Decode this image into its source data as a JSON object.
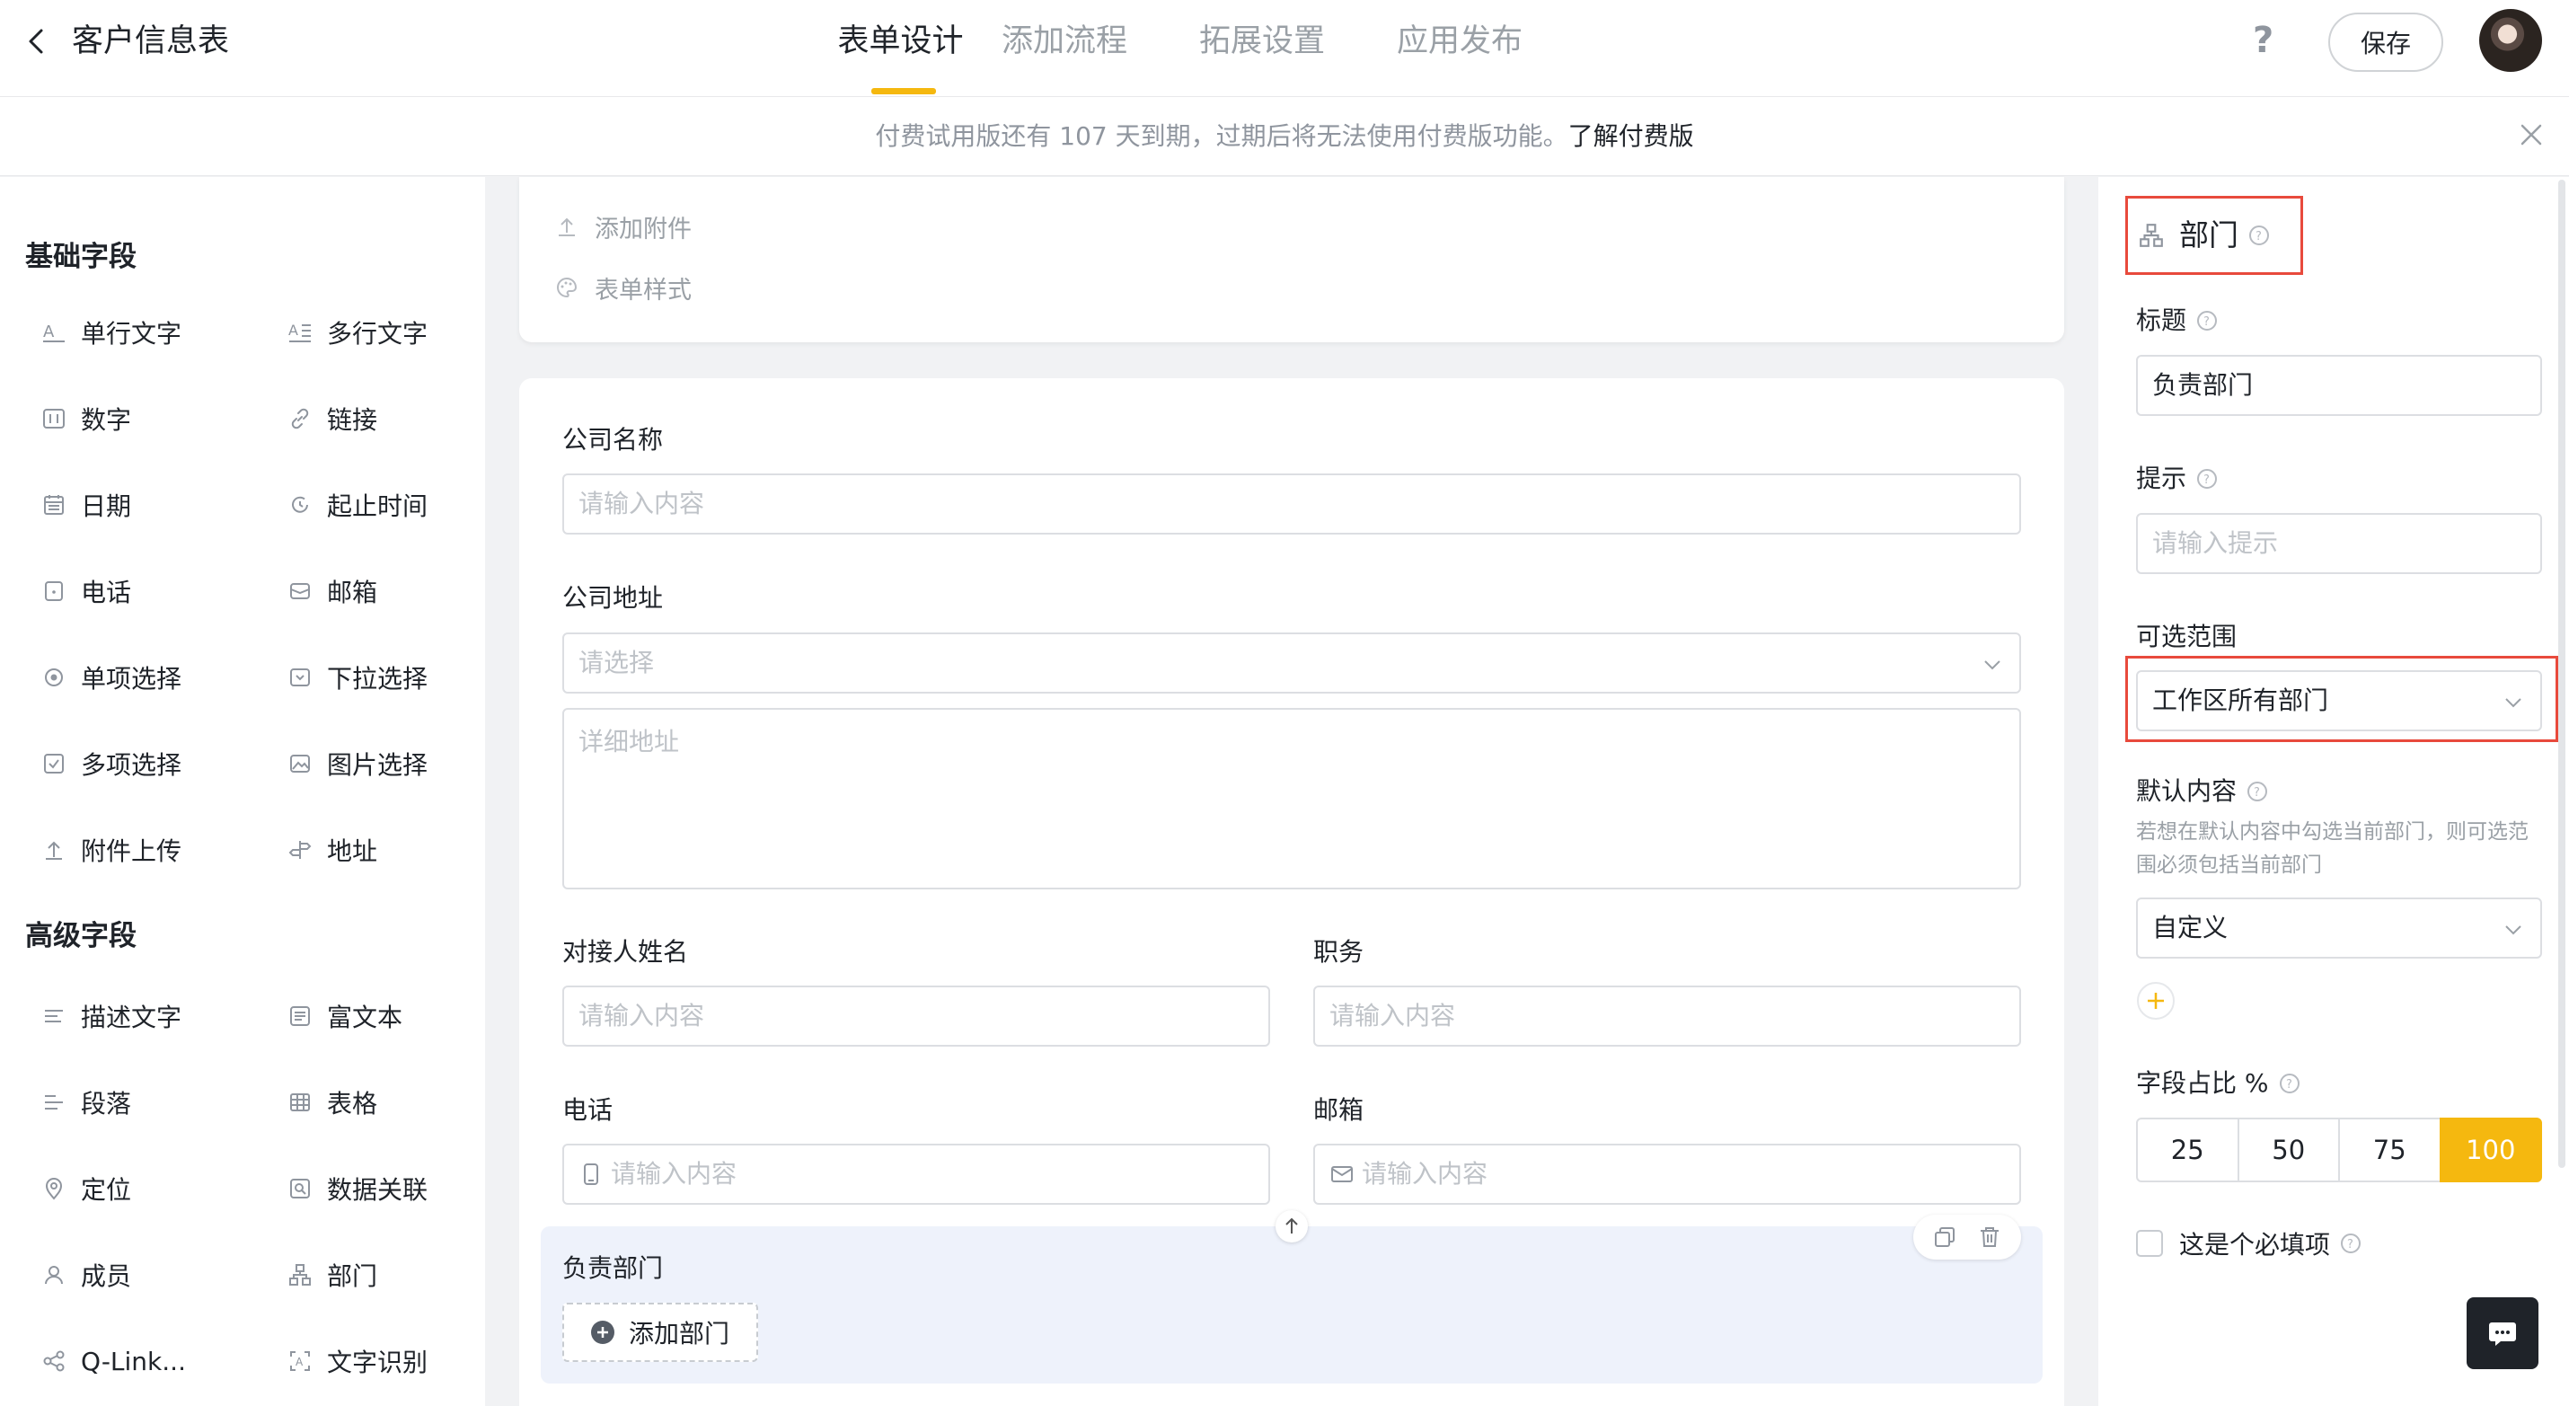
{
  "header": {
    "title": "客户信息表",
    "tabs": [
      {
        "label": "表单设计",
        "active": true
      },
      {
        "label": "添加流程",
        "active": false
      },
      {
        "label": "拓展设置",
        "active": false
      },
      {
        "label": "应用发布",
        "active": false
      }
    ],
    "help_glyph": "?",
    "save_label": "保存"
  },
  "notice": {
    "text": "付费试用版还有 107 天到期，过期后将无法使用付费版功能。",
    "link": "了解付费版"
  },
  "left": {
    "basic_title": "基础字段",
    "basic_fields": [
      {
        "label": "单行文字",
        "icon": "single-text-icon"
      },
      {
        "label": "多行文字",
        "icon": "multi-text-icon"
      },
      {
        "label": "数字",
        "icon": "number-icon"
      },
      {
        "label": "链接",
        "icon": "link-icon"
      },
      {
        "label": "日期",
        "icon": "calendar-icon"
      },
      {
        "label": "起止时间",
        "icon": "time-range-icon"
      },
      {
        "label": "电话",
        "icon": "phone-icon"
      },
      {
        "label": "邮箱",
        "icon": "mail-icon"
      },
      {
        "label": "单项选择",
        "icon": "radio-icon"
      },
      {
        "label": "下拉选择",
        "icon": "dropdown-icon"
      },
      {
        "label": "多项选择",
        "icon": "checkbox-icon"
      },
      {
        "label": "图片选择",
        "icon": "image-icon"
      },
      {
        "label": "附件上传",
        "icon": "upload-icon"
      },
      {
        "label": "地址",
        "icon": "signpost-icon"
      }
    ],
    "advanced_title": "高级字段",
    "advanced_fields": [
      {
        "label": "描述文字",
        "icon": "description-icon"
      },
      {
        "label": "富文本",
        "icon": "rich-text-icon"
      },
      {
        "label": "段落",
        "icon": "paragraph-icon"
      },
      {
        "label": "表格",
        "icon": "table-icon"
      },
      {
        "label": "定位",
        "icon": "location-icon"
      },
      {
        "label": "数据关联",
        "icon": "data-link-icon"
      },
      {
        "label": "成员",
        "icon": "member-icon"
      },
      {
        "label": "部门",
        "icon": "department-icon"
      },
      {
        "label": "Q-Link...",
        "icon": "share-icon"
      },
      {
        "label": "文字识别",
        "icon": "ocr-icon"
      }
    ]
  },
  "center": {
    "top_rows": [
      {
        "label": "添加附件",
        "icon": "upload-icon"
      },
      {
        "label": "表单样式",
        "icon": "palette-icon"
      }
    ],
    "company_name": {
      "label": "公司名称",
      "placeholder": "请输入内容"
    },
    "company_address": {
      "label": "公司地址",
      "select_placeholder": "请选择",
      "detail_placeholder": "详细地址"
    },
    "contact_name": {
      "label": "对接人姓名",
      "placeholder": "请输入内容"
    },
    "position": {
      "label": "职务",
      "placeholder": "请输入内容"
    },
    "phone": {
      "label": "电话",
      "placeholder": "请输入内容"
    },
    "email": {
      "label": "邮箱",
      "placeholder": "请输入内容"
    },
    "department": {
      "label": "负责部门",
      "add_label": "添加部门"
    }
  },
  "right": {
    "title": "部门",
    "title_label": "标题",
    "title_value": "负责部门",
    "hint_label": "提示",
    "hint_placeholder": "请输入提示",
    "range_label": "可选范围",
    "range_value": "工作区所有部门",
    "default_label": "默认内容",
    "default_hint": "若想在默认内容中勾选当前部门，则可选范围必须包括当前部门",
    "default_value": "自定义",
    "width_label": "字段占比 %",
    "width_options": [
      "25",
      "50",
      "75",
      "100"
    ],
    "width_selected": "100",
    "required_label": "这是个必填项"
  },
  "colors": {
    "accent": "#f5b80f",
    "highlight_border": "#e84a3c"
  }
}
